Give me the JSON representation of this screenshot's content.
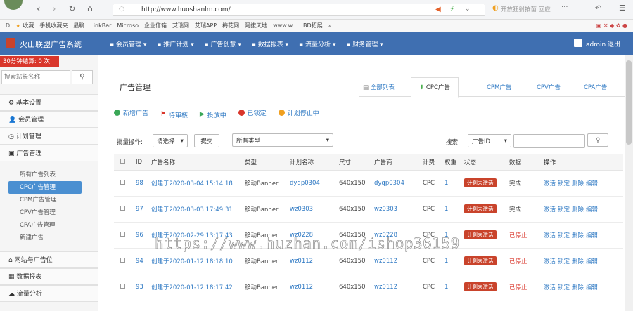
{
  "browser": {
    "url": "http://www.huoshanlm.com/",
    "search_hint": "开放狂射按苗 回应"
  },
  "bookmarks": [
    "收藏",
    "手机收藏夹",
    "最聊",
    "LinkBar",
    "Microso",
    "企业信箱",
    "艾瑞网",
    "艾瑞APP",
    "梅花网",
    "阿拔天地",
    "www.w...",
    "BD拓展"
  ],
  "app": {
    "logo": "火山联盟广告系统",
    "nav": [
      "会员管理",
      "推广计划",
      "广告创意",
      "数据报表",
      "流量分析",
      "财务管理"
    ],
    "user": "admin 退出"
  },
  "sidebar": {
    "balance": "30分钟结算: 0 次",
    "search_placeholder": "搜索站长名称",
    "sections": [
      {
        "label": "基本设置"
      },
      {
        "label": "会员管理"
      },
      {
        "label": "计划管理"
      },
      {
        "label": "广告管理"
      }
    ],
    "sub": [
      "所有广告列表",
      "CPC广告管理",
      "CPM广告管理",
      "CPV广告管理",
      "CPA广告管理",
      "新建广告"
    ],
    "bottom": [
      {
        "label": "网站与广告位"
      },
      {
        "label": "数据报表"
      },
      {
        "label": "流量分析"
      }
    ]
  },
  "main": {
    "title": "广告管理",
    "tabs": [
      "全部列表",
      "CPC广告",
      "CPM广告",
      "CPV广告",
      "CPA广告"
    ],
    "actions": [
      "新增广告",
      "待审核",
      "投放中",
      "已锁定",
      "计划停止中"
    ],
    "batch_label": "批量操作:",
    "batch_select": "请选择",
    "submit": "提交",
    "type_select": "所有类型",
    "search_label": "搜索:",
    "search_field": "广告ID",
    "columns": [
      "ID",
      "广告名称",
      "类型",
      "计划名称",
      "尺寸",
      "广告商",
      "计费",
      "权重",
      "状态",
      "数据",
      "操作"
    ],
    "rows": [
      {
        "id": "98",
        "name": "创建于2020-03-04 15:14:18",
        "type": "移动Banner",
        "plan": "dyqp0304",
        "size": "640x150",
        "adv": "dyqp0304",
        "billing": "CPC",
        "weight": "1",
        "status": "计划未激活",
        "data": "完成",
        "ops": [
          "激活",
          "锁定",
          "删除",
          "编辑"
        ]
      },
      {
        "id": "97",
        "name": "创建于2020-03-03 17:49:31",
        "type": "移动Banner",
        "plan": "wz0303",
        "size": "640x150",
        "adv": "wz0303",
        "billing": "CPC",
        "weight": "1",
        "status": "计划未激活",
        "data": "完成",
        "ops": [
          "激活",
          "锁定",
          "删除",
          "编辑"
        ]
      },
      {
        "id": "96",
        "name": "创建于2020-02-29 13:17:43",
        "type": "移动Banner",
        "plan": "wz0228",
        "size": "640x150",
        "adv": "wz0228",
        "billing": "CPC",
        "weight": "1",
        "status": "计划未激活",
        "data": "已停止",
        "ops": [
          "激活",
          "锁定",
          "删除",
          "编辑"
        ]
      },
      {
        "id": "94",
        "name": "创建于2020-01-12 18:18:10",
        "type": "移动Banner",
        "plan": "wz0112",
        "size": "640x150",
        "adv": "wz0112",
        "billing": "CPC",
        "weight": "1",
        "status": "计划未激活",
        "data": "已停止",
        "ops": [
          "激活",
          "锁定",
          "删除",
          "编辑"
        ]
      },
      {
        "id": "93",
        "name": "创建于2020-01-12 18:17:42",
        "type": "移动Banner",
        "plan": "wz0112",
        "size": "640x150",
        "adv": "wz0112",
        "billing": "CPC",
        "weight": "1",
        "status": "计划未激活",
        "data": "已停止",
        "ops": [
          "激活",
          "锁定",
          "删除",
          "编辑"
        ]
      }
    ]
  },
  "watermark": "https://www.huzhan.com/ishop36159"
}
